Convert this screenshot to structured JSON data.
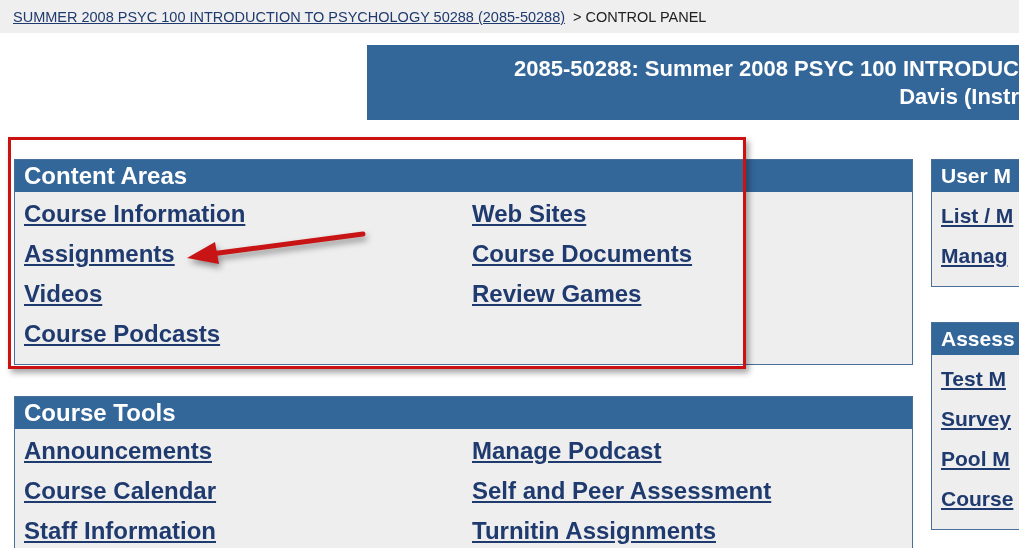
{
  "breadcrumb": {
    "link": "SUMMER 2008 PSYC 100 INTRODUCTION TO PSYCHOLOGY 50288 (2085-50288)",
    "current": "> CONTROL PANEL"
  },
  "banner": {
    "lines": [
      "2085-50288: Summer 2008 PSYC 100 INTRODUC",
      "Davis (Instr"
    ]
  },
  "left_panels": [
    {
      "title": "Content Areas",
      "highlighted": true,
      "columns": [
        [
          {
            "label": "Course Information",
            "pointed": false
          },
          {
            "label": "Assignments",
            "pointed": true
          },
          {
            "label": "Videos",
            "pointed": false
          },
          {
            "label": "Course Podcasts",
            "pointed": false
          }
        ],
        [
          {
            "label": "Web Sites",
            "pointed": false
          },
          {
            "label": "Course Documents",
            "pointed": false
          },
          {
            "label": "Review Games",
            "pointed": false
          }
        ]
      ]
    },
    {
      "title": "Course Tools",
      "highlighted": false,
      "columns": [
        [
          {
            "label": "Announcements",
            "pointed": false
          },
          {
            "label": "Course Calendar",
            "pointed": false
          },
          {
            "label": "Staff Information",
            "pointed": false
          }
        ],
        [
          {
            "label": "Manage Podcast",
            "pointed": false
          },
          {
            "label": "Self and Peer Assessment",
            "pointed": false
          },
          {
            "label": "Turnitin Assignments",
            "pointed": false
          }
        ]
      ]
    }
  ],
  "right_panels": [
    {
      "title": "User M",
      "links": [
        "List / M",
        "Manag"
      ]
    },
    {
      "title": "Assess",
      "links": [
        "Test M",
        "Survey",
        "Pool M",
        "Course"
      ]
    }
  ]
}
